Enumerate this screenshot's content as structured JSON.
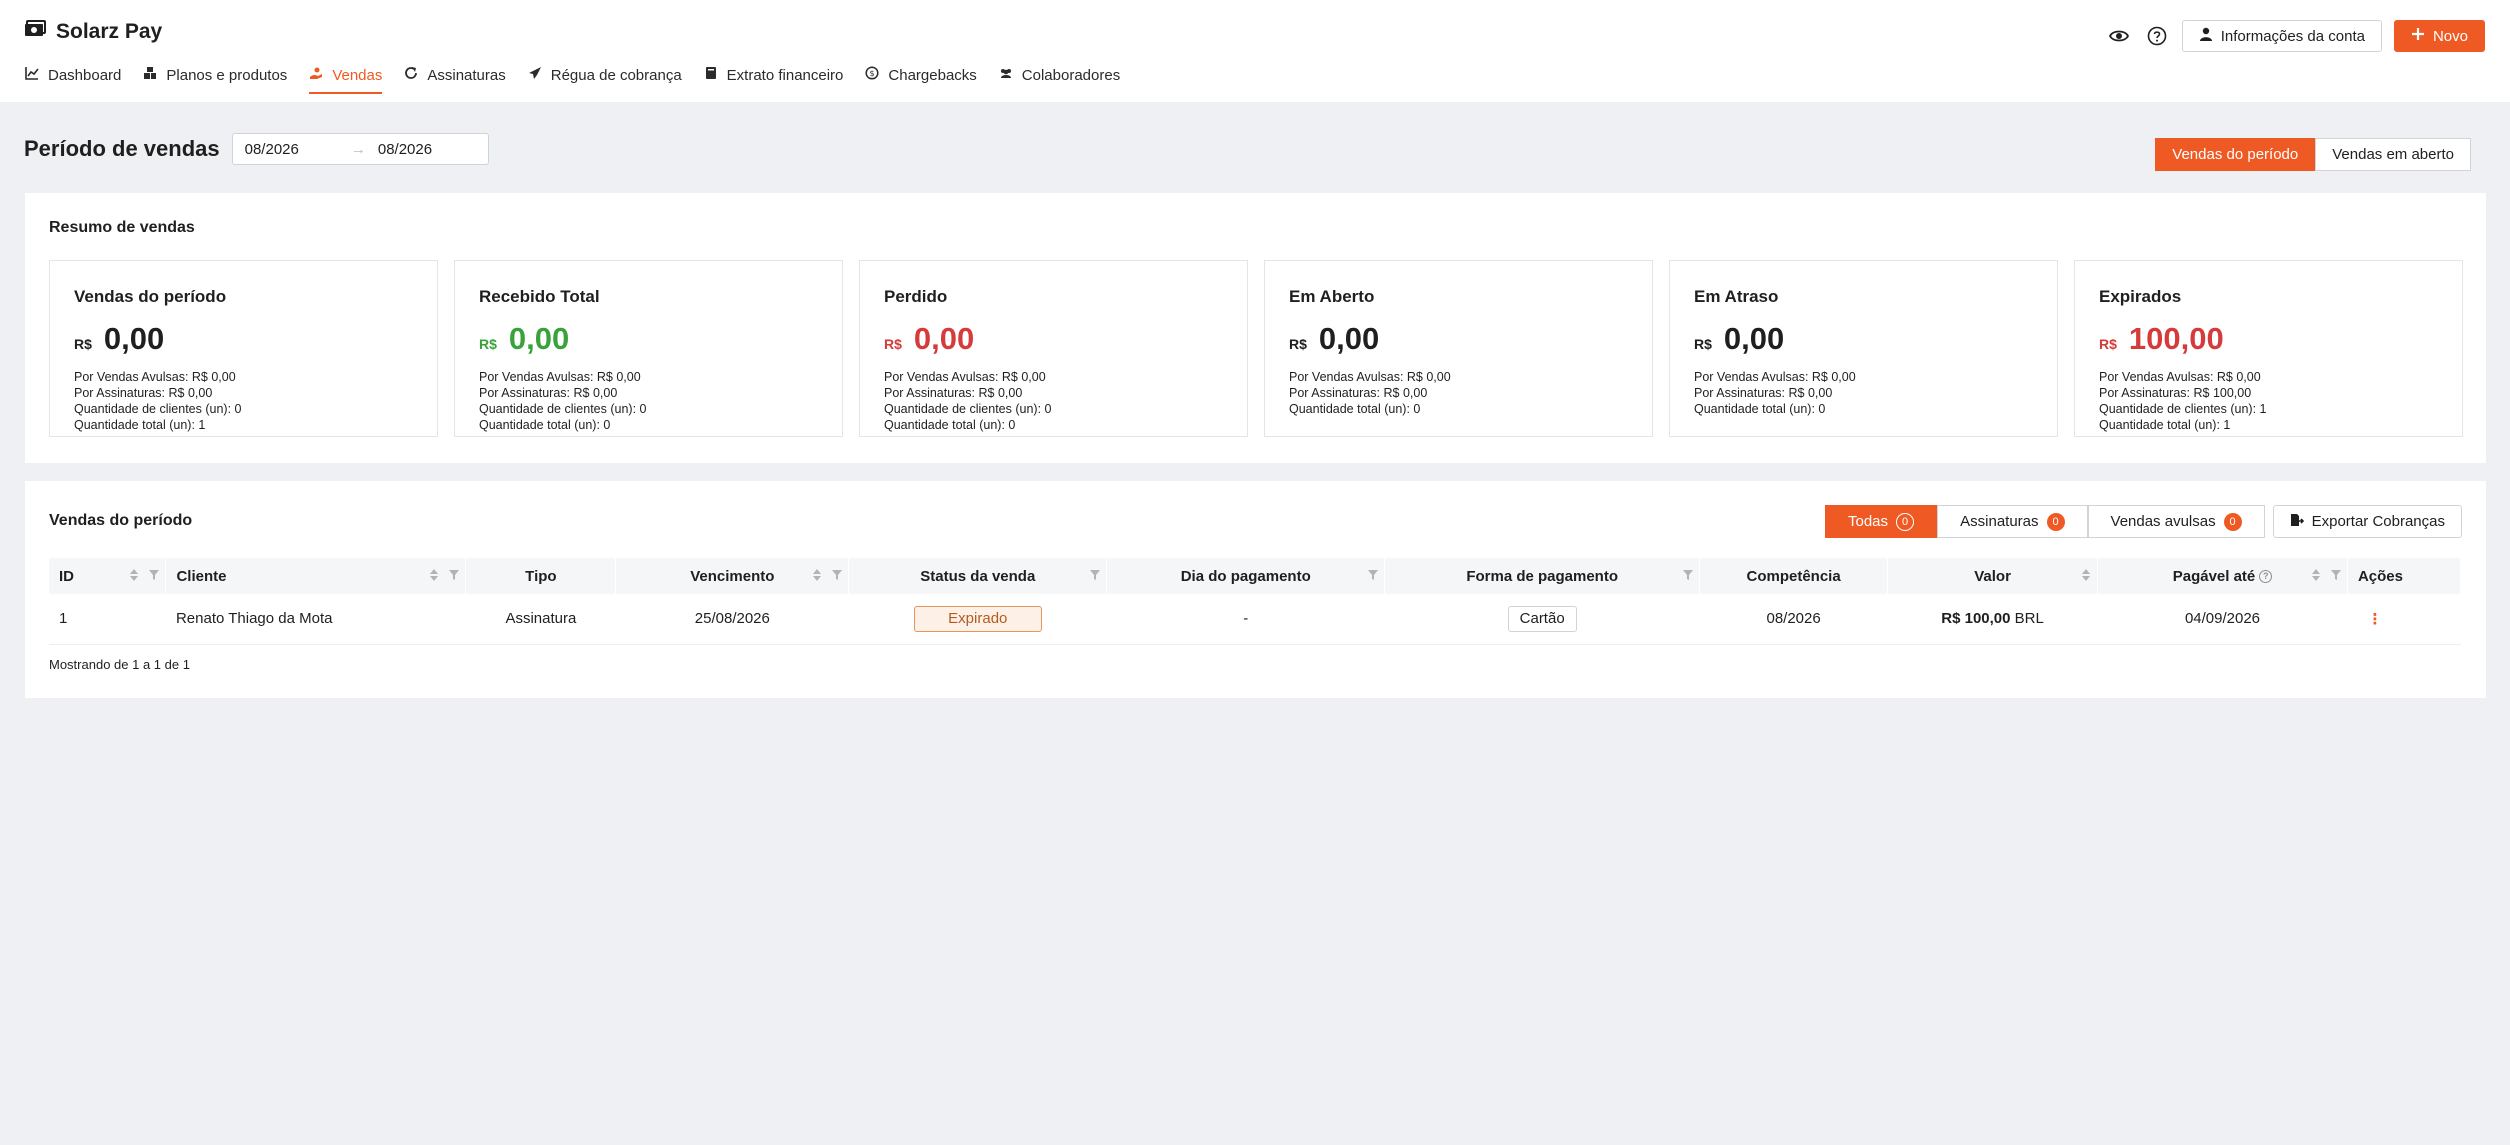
{
  "app": {
    "title": "Solarz Pay"
  },
  "top_actions": {
    "account_label": "Informações da conta",
    "new_label": "Novo"
  },
  "nav": [
    {
      "label": "Dashboard",
      "icon": "chart-line-icon"
    },
    {
      "label": "Planos e produtos",
      "icon": "boxes-icon"
    },
    {
      "label": "Vendas",
      "icon": "hand-coin-icon",
      "active": true
    },
    {
      "label": "Assinaturas",
      "icon": "refresh-icon"
    },
    {
      "label": "Régua de cobrança",
      "icon": "send-icon"
    },
    {
      "label": "Extrato financeiro",
      "icon": "book-icon"
    },
    {
      "label": "Chargebacks",
      "icon": "coin-icon"
    },
    {
      "label": "Colaboradores",
      "icon": "users-icon"
    }
  ],
  "period": {
    "title": "Período de vendas",
    "start": "08/2026",
    "end": "08/2026",
    "toggle": [
      "Vendas do período",
      "Vendas em aberto"
    ]
  },
  "summary": {
    "title": "Resumo de vendas",
    "cards": [
      {
        "title": "Vendas do período",
        "currency": "R$",
        "value": "0,00",
        "tone": "default",
        "lines": [
          "Por Vendas Avulsas: R$ 0,00",
          "Por Assinaturas: R$ 0,00",
          "Quantidade de clientes (un): 0",
          "Quantidade total (un): 1"
        ]
      },
      {
        "title": "Recebido Total",
        "currency": "R$",
        "value": "0,00",
        "tone": "green",
        "lines": [
          "Por Vendas Avulsas: R$ 0,00",
          "Por Assinaturas: R$ 0,00",
          "Quantidade de clientes (un): 0",
          "Quantidade total (un): 0"
        ]
      },
      {
        "title": "Perdido",
        "currency": "R$",
        "value": "0,00",
        "tone": "red",
        "lines": [
          "Por Vendas Avulsas: R$ 0,00",
          "Por Assinaturas: R$ 0,00",
          "Quantidade de clientes (un): 0",
          "Quantidade total (un): 0"
        ]
      },
      {
        "title": "Em Aberto",
        "currency": "R$",
        "value": "0,00",
        "tone": "default",
        "lines": [
          "Por Vendas Avulsas: R$ 0,00",
          "Por Assinaturas: R$ 0,00",
          "Quantidade total (un): 0"
        ]
      },
      {
        "title": "Em Atraso",
        "currency": "R$",
        "value": "0,00",
        "tone": "default",
        "lines": [
          "Por Vendas Avulsas: R$ 0,00",
          "Por Assinaturas: R$ 0,00",
          "Quantidade total (un): 0"
        ]
      },
      {
        "title": "Expirados",
        "currency": "R$",
        "value": "100,00",
        "tone": "red",
        "lines": [
          "Por Vendas Avulsas: R$ 0,00",
          "Por Assinaturas: R$ 100,00",
          "Quantidade de clientes (un): 1",
          "Quantidade total (un): 1"
        ]
      }
    ]
  },
  "sales": {
    "title": "Vendas do período",
    "tabs": [
      {
        "label": "Todas",
        "count": "0"
      },
      {
        "label": "Assinaturas",
        "count": "0"
      },
      {
        "label": "Vendas avulsas",
        "count": "0"
      }
    ],
    "export_label": "Exportar Cobranças",
    "columns": [
      "ID",
      "Cliente",
      "Tipo",
      "Vencimento",
      "Status da venda",
      "Dia do pagamento",
      "Forma de pagamento",
      "Competência",
      "Valor",
      "Pagável até",
      "Ações"
    ],
    "rows": [
      {
        "id": "1",
        "client": "Renato Thiago da Mota",
        "type": "Assinatura",
        "due": "25/08/2026",
        "status": "Expirado",
        "payment_day": "-",
        "method": "Cartão",
        "competence": "08/2026",
        "value_amount": "R$ 100,00",
        "value_currency": "BRL",
        "payable_until": "04/09/2026",
        "actions": "⋮"
      }
    ],
    "footer": "Mostrando de 1 a 1 de 1"
  },
  "colors": {
    "accent": "#ef5a24",
    "green": "#3aa23a",
    "red": "#d63b3b"
  }
}
